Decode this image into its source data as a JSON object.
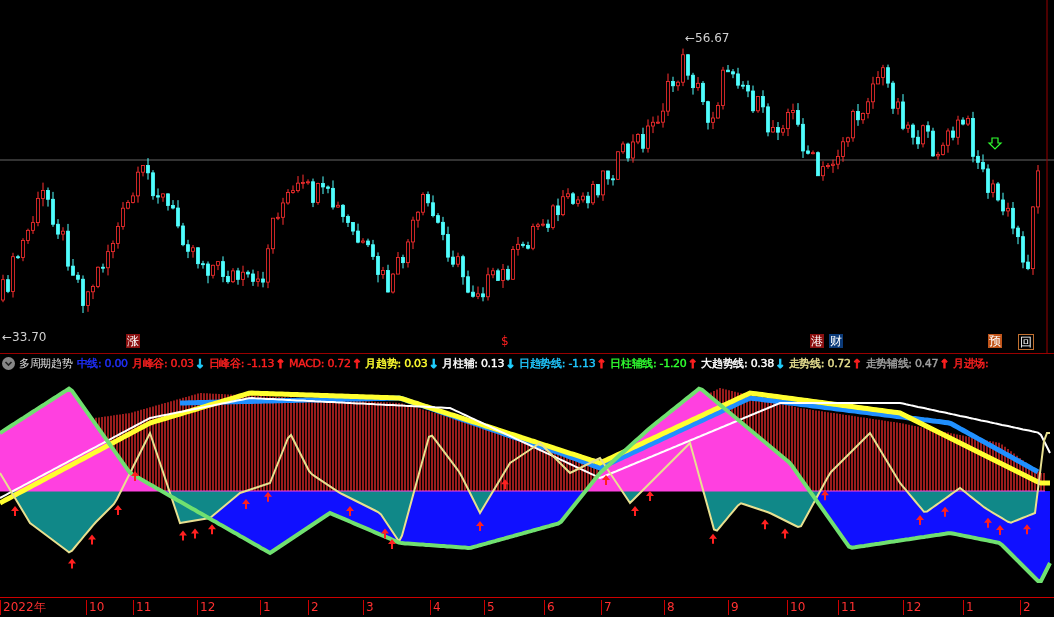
{
  "price_chart": {
    "high_label": "←56.67",
    "low_label": "←33.70",
    "markers": [
      {
        "text": "涨",
        "kind": "filled",
        "color": "#8b1010"
      },
      {
        "text": "$",
        "kind": "plain",
        "color": "#ff2020"
      },
      {
        "text": "港",
        "kind": "filled",
        "color": "#8b1010"
      },
      {
        "text": "财",
        "kind": "filled",
        "color": "#0b3a78"
      },
      {
        "text": "预",
        "kind": "filled",
        "color": "#c0541a"
      },
      {
        "text": "回",
        "kind": "outline",
        "color": "#c07030"
      }
    ]
  },
  "indicator": {
    "title": "多周期趋势",
    "legend": [
      {
        "text": "中线: 0.00",
        "color": "#2030ff"
      },
      {
        "text": "月峰谷: 0.03",
        "color": "#ff2020",
        "arrow": {
          "text": "↓",
          "color": "#20d0ff"
        }
      },
      {
        "text": "日峰谷: -1.13",
        "color": "#ff2020",
        "arrow": {
          "text": "↑",
          "color": "#ff2020"
        }
      },
      {
        "text": "MACD: 0.72",
        "color": "#ff2020",
        "arrow": {
          "text": "↑",
          "color": "#ff2020"
        }
      },
      {
        "text": "月趋势: 0.03",
        "color": "#ffff30",
        "arrow": {
          "text": "↓",
          "color": "#20d0ff"
        }
      },
      {
        "text": "月柱辅: 0.13",
        "color": "#ffffff",
        "arrow": {
          "text": "↓",
          "color": "#20d0ff"
        }
      },
      {
        "text": "日趋势线: -1.13",
        "color": "#20c8ff",
        "arrow": {
          "text": "↑",
          "color": "#ff2020"
        }
      },
      {
        "text": "日柱辅线: -1.20",
        "color": "#30ff30",
        "arrow": {
          "text": "↑",
          "color": "#ff2020"
        }
      },
      {
        "text": "大趋势线: 0.38",
        "color": "#ffffff",
        "arrow": {
          "text": "↓",
          "color": "#20d0ff"
        }
      },
      {
        "text": "走势线: 0.72",
        "color": "#e8e090",
        "arrow": {
          "text": "↑",
          "color": "#ff2020"
        }
      },
      {
        "text": "走势辅线: 0.47",
        "color": "#a0a0a0",
        "arrow": {
          "text": "↑",
          "color": "#ff2020"
        }
      },
      {
        "text": "月进场:",
        "color": "#ff2020"
      }
    ]
  },
  "time_axis": [
    "2022年",
    "10",
    "11",
    "12",
    "1",
    "2",
    "3",
    "4",
    "5",
    "6",
    "7",
    "8",
    "9",
    "10",
    "11",
    "12",
    "1",
    "2"
  ]
}
